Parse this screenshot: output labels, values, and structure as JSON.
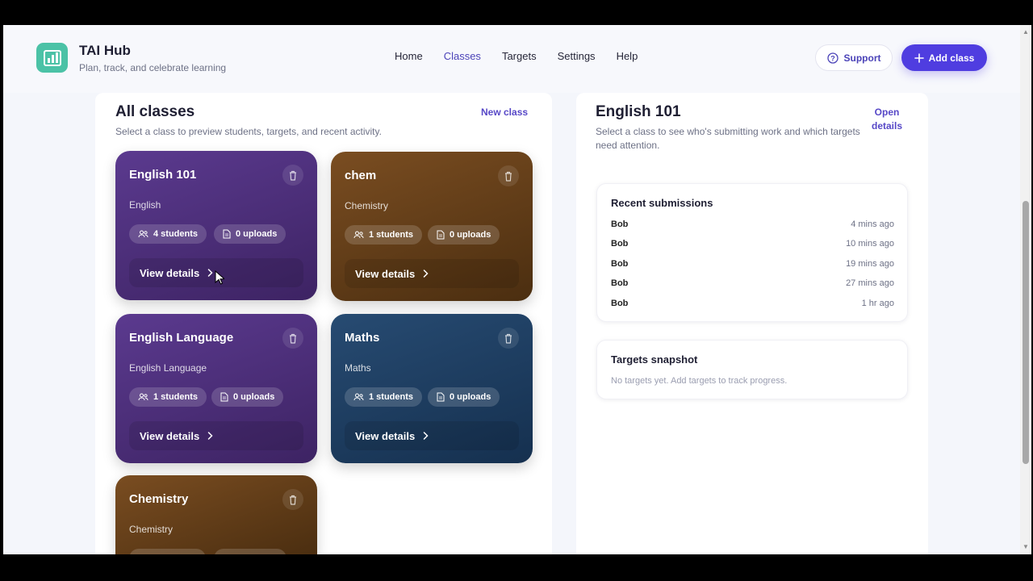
{
  "app": {
    "title": "TAI Hub",
    "tagline": "Plan, track, and celebrate learning"
  },
  "nav": [
    {
      "label": "Home",
      "active": false
    },
    {
      "label": "Classes",
      "active": true
    },
    {
      "label": "Targets",
      "active": false
    },
    {
      "label": "Settings",
      "active": false
    },
    {
      "label": "Help",
      "active": false
    }
  ],
  "header_actions": {
    "support_label": "Support",
    "add_class_label": "Add class"
  },
  "classes_panel": {
    "title": "All classes",
    "subtitle": "Select a class to preview students, targets, and recent activity.",
    "new_class_label": "New class"
  },
  "cards": [
    {
      "name": "English 101",
      "subject": "English",
      "students": "4 students",
      "uploads": "0 uploads",
      "view_label": "View details",
      "theme": "purple"
    },
    {
      "name": "chem",
      "subject": "Chemistry",
      "students": "1 students",
      "uploads": "0 uploads",
      "view_label": "View details",
      "theme": "brown"
    },
    {
      "name": "English Language",
      "subject": "English Language",
      "students": "1 students",
      "uploads": "0 uploads",
      "view_label": "View details",
      "theme": "purple"
    },
    {
      "name": "Maths",
      "subject": "Maths",
      "students": "1 students",
      "uploads": "0 uploads",
      "view_label": "View details",
      "theme": "blue"
    },
    {
      "name": "Chemistry",
      "subject": "Chemistry",
      "students": "",
      "uploads": "",
      "view_label": "",
      "theme": "brown"
    }
  ],
  "detail_panel": {
    "title": "English 101",
    "subtitle": "Select a class to see who's submitting work and which targets need attention.",
    "open_details_label": "Open details",
    "recent_title": "Recent submissions",
    "submissions": [
      {
        "name": "Bob",
        "time": "4 mins ago"
      },
      {
        "name": "Bob",
        "time": "10 mins ago"
      },
      {
        "name": "Bob",
        "time": "19 mins ago"
      },
      {
        "name": "Bob",
        "time": "27 mins ago"
      },
      {
        "name": "Bob",
        "time": "1 hr ago"
      }
    ],
    "targets_title": "Targets snapshot",
    "targets_empty": "No targets yet. Add targets to track progress."
  },
  "colors": {
    "accent": "#4f3de0",
    "logo": "#4bc2a6",
    "card_purple": "#4a2c78",
    "card_brown": "#5e3a16",
    "card_blue": "#1d3a5e"
  },
  "icons": {
    "logo": "chart-bars-icon",
    "support": "help-circle-icon",
    "add": "plus-icon",
    "delete": "trash-icon",
    "students": "users-icon",
    "uploads": "file-icon",
    "view": "chevron-right-icon"
  }
}
